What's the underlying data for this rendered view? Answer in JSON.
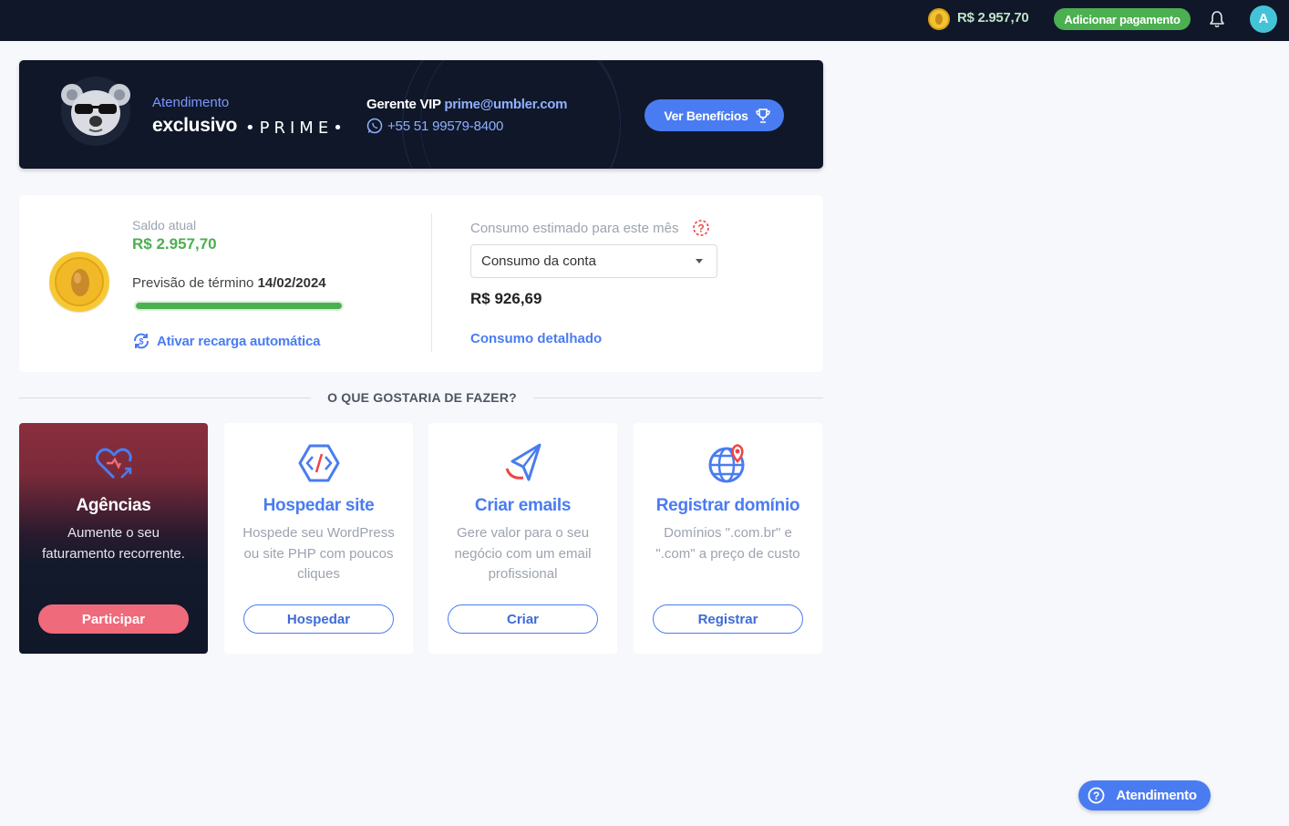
{
  "topbar": {
    "balance": "R$ 2.957,70",
    "add_payment_label": "Adicionar pagamento",
    "avatar_initial": "A"
  },
  "prime": {
    "service_label": "Atendimento",
    "exclusive_label": "exclusivo",
    "prime_label": "•PRIME•",
    "manager_label": "Gerente VIP",
    "manager_email": "prime@umbler.com",
    "phone": "+55 51 99579-8400",
    "benefits_button": "Ver Benefícios"
  },
  "balance_card": {
    "current_label": "Saldo atual",
    "current_value": "R$ 2.957,70",
    "forecast_label": "Previsão de término",
    "forecast_date": "14/02/2024",
    "progress_percent": 100,
    "auto_recharge_link": "Ativar recarga automática",
    "consumption_label": "Consumo estimado para este mês",
    "consumption_select": "Consumo da conta",
    "consumption_value": "R$ 926,69",
    "consumption_link": "Consumo detalhado"
  },
  "actions": {
    "section_title": "O QUE GOSTARIA DE FAZER?",
    "cards": [
      {
        "title": "Agências",
        "desc": "Aumente o seu faturamento recorrente.",
        "button": "Participar",
        "icon": "heart-growth-icon"
      },
      {
        "title": "Hospedar site",
        "desc": "Hospede seu WordPress ou site PHP com poucos cliques",
        "button": "Hospedar",
        "icon": "code-hexagon-icon"
      },
      {
        "title": "Criar emails",
        "desc": "Gere valor para o seu negócio com um email profissional",
        "button": "Criar",
        "icon": "paper-plane-icon"
      },
      {
        "title": "Registrar domínio",
        "desc": "Domínios \".com.br\" e \".com\" a preço de custo",
        "button": "Registrar",
        "icon": "globe-pin-icon"
      }
    ]
  },
  "support": {
    "button_label": "Atendimento"
  },
  "colors": {
    "navy": "#0f1729",
    "accent_blue": "#4a7cf1",
    "green": "#4caf50",
    "pink": "#ef6a7a"
  }
}
